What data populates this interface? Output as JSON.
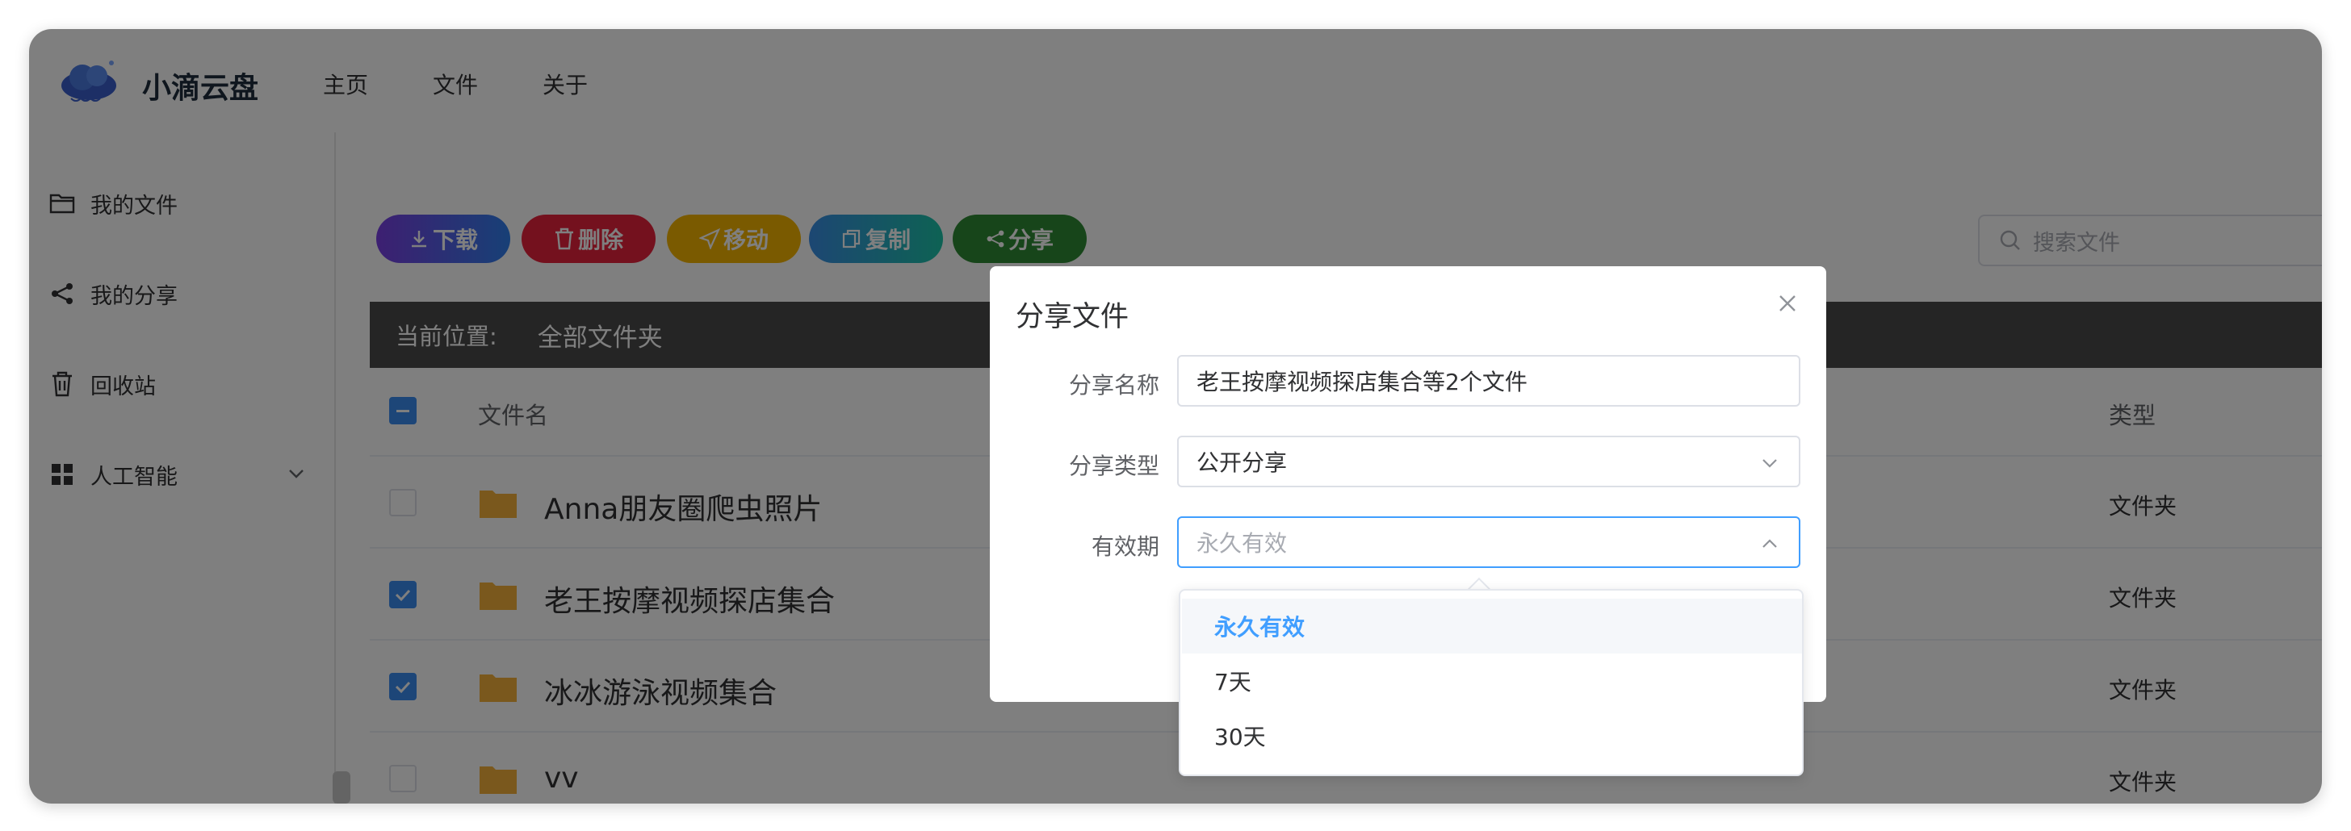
{
  "app": {
    "brand": "小滴云盘"
  },
  "nav": [
    "主页",
    "文件",
    "关于"
  ],
  "sidebar": {
    "items": [
      {
        "label": "我的文件",
        "icon": "folder-open-icon"
      },
      {
        "label": "我的分享",
        "icon": "share-icon"
      },
      {
        "label": "回收站",
        "icon": "trash-icon"
      },
      {
        "label": "人工智能",
        "icon": "grid-icon"
      }
    ]
  },
  "toolbar": {
    "download": "下载",
    "delete": "删除",
    "move": "移动",
    "copy": "复制",
    "share": "分享"
  },
  "search": {
    "placeholder": "搜索文件"
  },
  "breadcrumb": {
    "prefix": "当前位置:",
    "current": "全部文件夹"
  },
  "table": {
    "headers": {
      "name": "文件名",
      "type": "类型"
    },
    "rows": [
      {
        "name": "Anna朋友圈爬虫照片",
        "type": "文件夹",
        "checked": false
      },
      {
        "name": "老王按摩视频探店集合",
        "type": "文件夹",
        "checked": true
      },
      {
        "name": "冰冰游泳视频集合",
        "type": "文件夹",
        "checked": true
      },
      {
        "name": "vv",
        "type": "文件夹",
        "checked": false
      }
    ]
  },
  "dialog": {
    "title": "分享文件",
    "fields": {
      "name_label": "分享名称",
      "name_value": "老王按摩视频探店集合等2个文件",
      "type_label": "分享类型",
      "type_value": "公开分享",
      "expire_label": "有效期",
      "expire_placeholder": "永久有效"
    },
    "expire_options": [
      "永久有效",
      "7天",
      "30天"
    ],
    "selected_option": "永久有效"
  },
  "colors": {
    "accent": "#409eff",
    "checkbox": "#3b8cf0",
    "download_start": "#7b3fe4",
    "download_end": "#2f80ed",
    "delete": "#e8233c",
    "move": "#f5b400",
    "copy_start": "#3a8ee6",
    "copy_end": "#1cc4a8",
    "share": "#2f8a34"
  }
}
